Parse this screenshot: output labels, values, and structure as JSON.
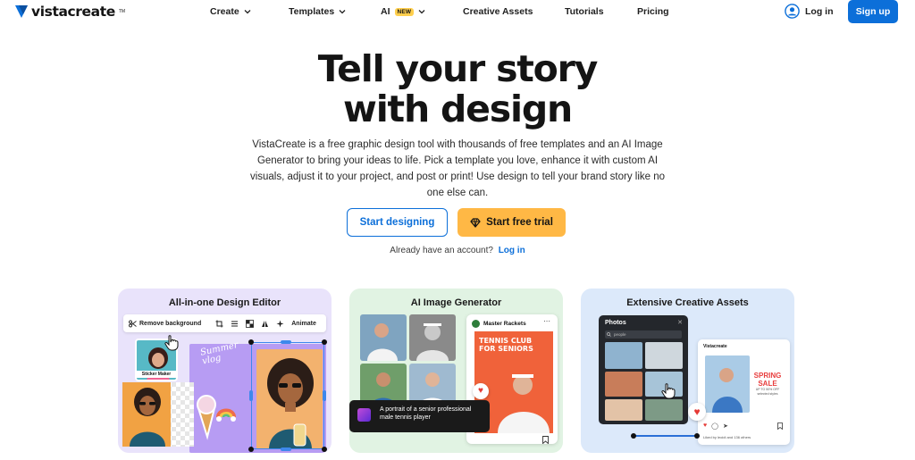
{
  "nav": {
    "brand": "vistacreate",
    "brand_tm": "TM",
    "items": [
      {
        "label": "Create",
        "has_chevron": true
      },
      {
        "label": "Templates",
        "has_chevron": true
      },
      {
        "label": "AI",
        "badge": "NEW",
        "has_chevron": true
      },
      {
        "label": "Creative Assets",
        "has_chevron": false
      },
      {
        "label": "Tutorials",
        "has_chevron": false
      },
      {
        "label": "Pricing",
        "has_chevron": false
      }
    ],
    "login_label": "Log in",
    "signup_label": "Sign up"
  },
  "hero": {
    "title_line1": "Tell your story",
    "title_line2": "with design",
    "description": "VistaCreate is a free graphic design tool with thousands of free templates and an AI Image Generator to bring your ideas to life. Pick a template you love, enhance it with custom AI visuals, adjust it to your project, and post or print! Use design to tell your brand story like no one else can.",
    "primary_button": "Start designing",
    "trial_button": "Start free trial",
    "account_prompt": "Already have an account?",
    "account_link": "Log in"
  },
  "cards": [
    {
      "title": "All-in-one Design Editor",
      "toolbar": {
        "remove_bg": "Remove background",
        "animate": "Animate"
      },
      "sticker_label": "Sticker Maker",
      "overlay_text": "Summer vlog"
    },
    {
      "title": "AI Image Generator",
      "account_name": "Master Rackets",
      "poster_title": "TENNIS CLUB FOR SENIORS",
      "prompt_text": "A portrait of a senior professional male tennis player"
    },
    {
      "title": "Extensive Creative Assets",
      "panel_title": "Photos",
      "search_text": "people",
      "post_brand": "Vistacreate",
      "sale_line1": "SPRING",
      "sale_line2": "SALE",
      "sale_sub1": "UP TO 50% OFF",
      "sale_sub2": "selected styles",
      "liked_by": "Liked by leoidi and 136 others"
    }
  ],
  "colors": {
    "brand_blue": "#0c6fd9",
    "trial_orange": "#ffb845",
    "new_badge": "#ffcf4d"
  }
}
